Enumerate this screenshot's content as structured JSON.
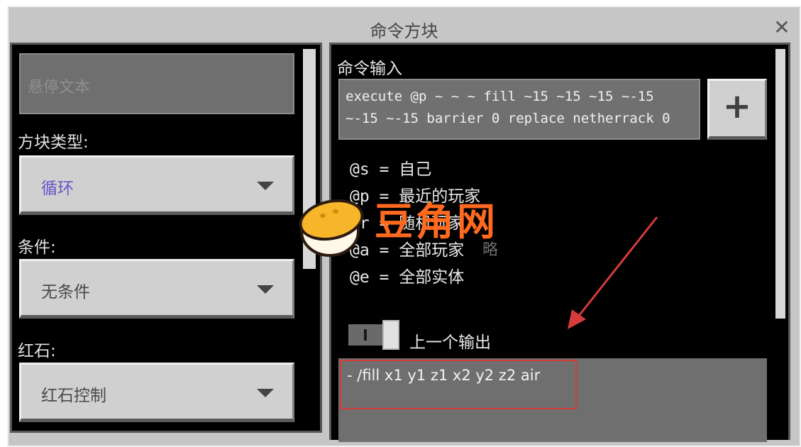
{
  "window": {
    "title": "命令方块",
    "close_glyph": "✕"
  },
  "left_panel": {
    "hover_text_placeholder": "悬停文本",
    "block_type_label": "方块类型:",
    "block_type_value": "循环",
    "condition_label": "条件:",
    "condition_value": "无条件",
    "redstone_label": "红石:",
    "redstone_value": "红石控制"
  },
  "right_panel": {
    "command_input_label": "命令输入",
    "command_line1": "execute @p ~ ~ ~ fill ~15 ~15 ~15 ~-15",
    "command_line2": "~-15 ~-15 barrier 0 replace netherrack 0",
    "plus_label": "+",
    "help": [
      "@s = 自己",
      "@p = 最近的玩家",
      "@r = 随机玩家",
      "@a = 全部玩家",
      "@e = 全部实体"
    ],
    "previous_output_label": "上一个输出",
    "previous_output_value": "- /fill x1 y1 z1 x2 y2 z2 air"
  },
  "watermark": {
    "brand": "豆角网",
    "sub": "略"
  },
  "colors": {
    "accent_highlight": "#d63b3b",
    "watermark_orange": "#ff6a1e",
    "dropdown_purple": "#6b54c9"
  }
}
